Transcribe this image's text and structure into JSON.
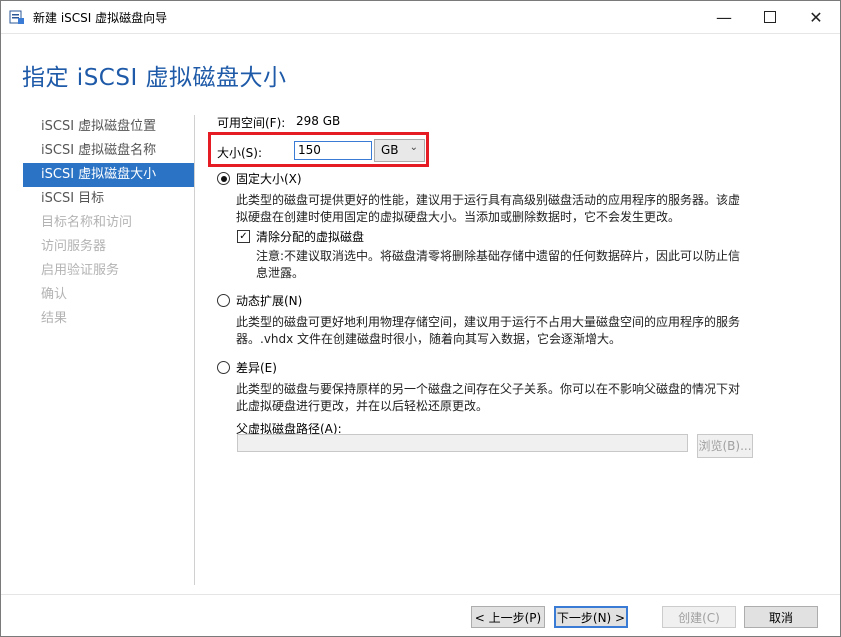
{
  "window": {
    "title": "新建 iSCSI 虚拟磁盘向导",
    "minimize_glyph": "—",
    "close_glyph": "✕",
    "icon": "wizard-app-icon"
  },
  "header": {
    "title": "指定 iSCSI 虚拟磁盘大小"
  },
  "nav": {
    "items": [
      {
        "label": "iSCSI 虚拟磁盘位置",
        "state": "normal"
      },
      {
        "label": "iSCSI 虚拟磁盘名称",
        "state": "normal"
      },
      {
        "label": "iSCSI 虚拟磁盘大小",
        "state": "active"
      },
      {
        "label": "iSCSI 目标",
        "state": "normal"
      },
      {
        "label": "目标名称和访问",
        "state": "disabled"
      },
      {
        "label": "访问服务器",
        "state": "disabled"
      },
      {
        "label": "启用验证服务",
        "state": "disabled"
      },
      {
        "label": "确认",
        "state": "disabled"
      },
      {
        "label": "结果",
        "state": "disabled"
      }
    ]
  },
  "main": {
    "free_space_label": "可用空间(F):",
    "free_space_value": "298 GB",
    "size_label": "大小(S):",
    "size_value": "150",
    "size_unit": "GB",
    "options": {
      "fixed": {
        "label": "固定大小(X)",
        "selected": true,
        "desc_line1": "此类型的磁盘可提供更好的性能，建议用于运行具有高级别磁盘活动的应用程序的服务器。该虚",
        "desc_line2": "拟硬盘在创建时使用固定的虚拟硬盘大小。当添加或删除数据时，它不会发生更改。",
        "clear_label": "清除分配的虚拟磁盘",
        "clear_checked": true,
        "clear_desc_line1": "注意:不建议取消选中。将磁盘清零将删除基础存储中遗留的任何数据碎片，因此可以防止信",
        "clear_desc_line2": "息泄露。"
      },
      "dynamic": {
        "label": "动态扩展(N)",
        "selected": false,
        "desc_line1": "此类型的磁盘可更好地利用物理存储空间，建议用于运行不占用大量磁盘空间的应用程序的服务",
        "desc_line2": "器。.vhdx 文件在创建磁盘时很小，随着向其写入数据，它会逐渐增大。"
      },
      "differencing": {
        "label": "差异(E)",
        "selected": false,
        "desc_line1": "此类型的磁盘与要保持原样的另一个磁盘之间存在父子关系。你可以在不影响父磁盘的情况下对",
        "desc_line2": "此虚拟硬盘进行更改，并在以后轻松还原更改。",
        "parent_path_label": "父虚拟磁盘路径(A):",
        "parent_path_value": "",
        "browse_label": "浏览(B)..."
      }
    }
  },
  "footer": {
    "prev": "< 上一步(P)",
    "next": "下一步(N) >",
    "create": "创建(C)",
    "cancel": "取消"
  },
  "colors": {
    "accent": "#2b73c4",
    "title": "#1e5aa8",
    "highlight": "#e51c23"
  }
}
